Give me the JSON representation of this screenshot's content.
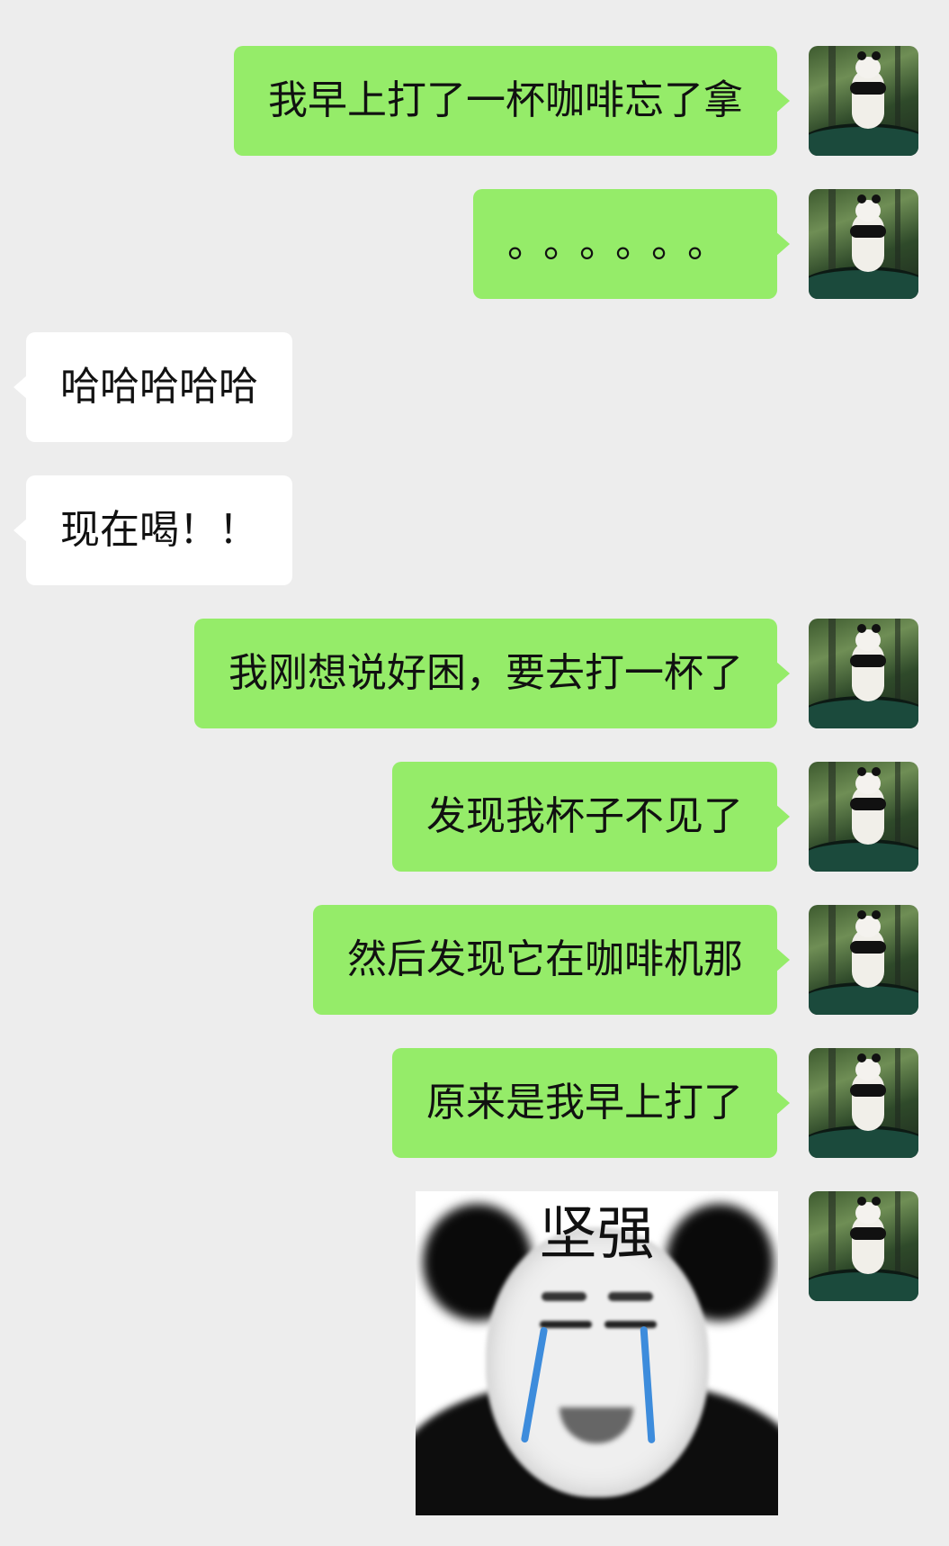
{
  "messages": [
    {
      "sender": "me",
      "text": "我早上打了一杯咖啡忘了拿"
    },
    {
      "sender": "me",
      "text": "。。。。。。"
    },
    {
      "sender": "them",
      "text": "哈哈哈哈哈"
    },
    {
      "sender": "them",
      "text": "现在喝！！"
    },
    {
      "sender": "me",
      "text": "我刚想说好困，要去打一杯了"
    },
    {
      "sender": "me",
      "text": "发现我杯子不见了"
    },
    {
      "sender": "me",
      "text": "然后发现它在咖啡机那"
    },
    {
      "sender": "me",
      "text": "原来是我早上打了"
    }
  ],
  "sticker": {
    "sender": "me",
    "caption": "坚强"
  },
  "colors": {
    "background": "#ededed",
    "my_bubble": "#95ec69",
    "their_bubble": "#ffffff"
  },
  "avatar_icon": "panda-avatar-icon"
}
